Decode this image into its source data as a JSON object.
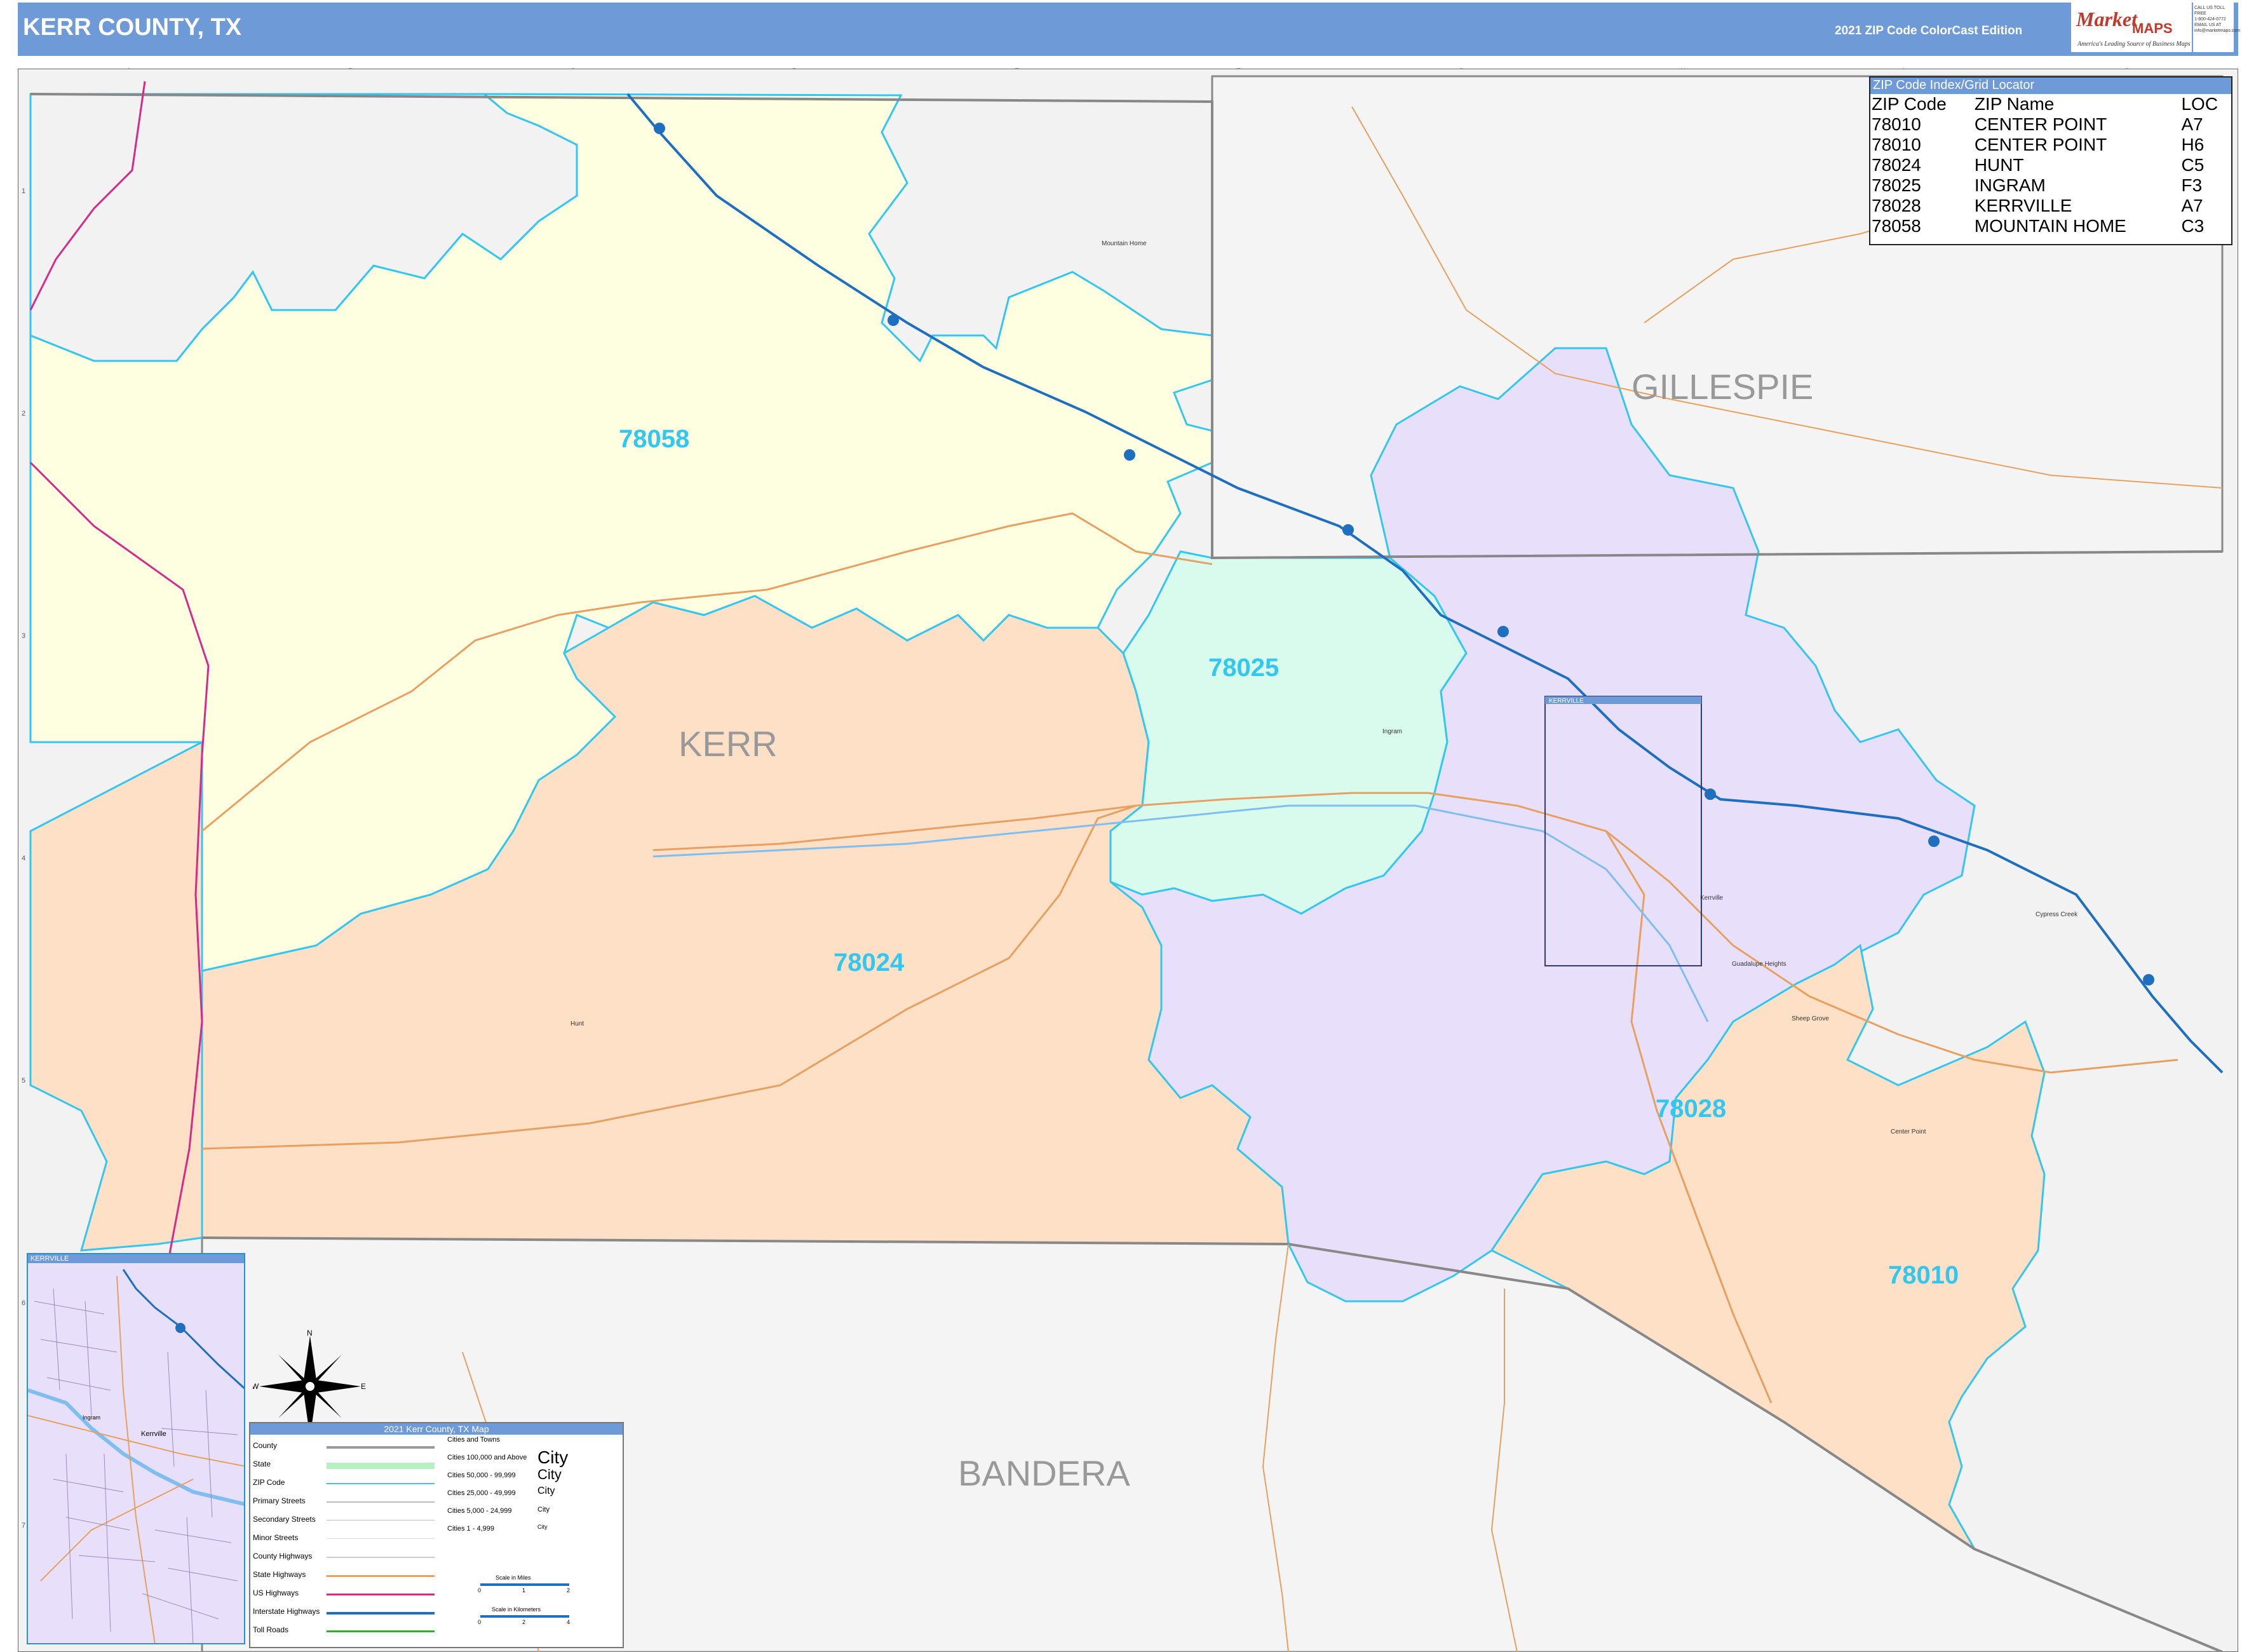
{
  "header": {
    "title": "KERR COUNTY, TX",
    "edition": "2021 ZIP Code ColorCast Edition",
    "logo_mark": "Market",
    "logo_maps": "MAPS",
    "logo_tagline": "America's Leading Source of Business Maps",
    "contact_lines": [
      "CALL US TOLL FREE",
      "1-800-424-0772",
      "EMAIL US AT",
      "info@marketmaps.com"
    ]
  },
  "grid": {
    "columns": [
      "A",
      "B",
      "C",
      "D",
      "E",
      "F",
      "G",
      "H",
      "I",
      "J"
    ],
    "rows": [
      "1",
      "2",
      "3",
      "4",
      "5",
      "6",
      "7"
    ]
  },
  "zip_index": {
    "title": "ZIP Code Index/Grid Locator",
    "headers": [
      "ZIP Code",
      "ZIP Name",
      "LOC"
    ],
    "rows": [
      [
        "78010",
        "CENTER POINT",
        "A7"
      ],
      [
        "78010",
        "CENTER POINT",
        "H6"
      ],
      [
        "78024",
        "HUNT",
        "C5"
      ],
      [
        "78025",
        "INGRAM",
        "F3"
      ],
      [
        "78028",
        "KERRVILLE",
        "A7"
      ],
      [
        "78058",
        "MOUNTAIN HOME",
        "C3"
      ]
    ]
  },
  "map": {
    "counties": {
      "kerr": "KERR",
      "gillespie": "GILLESPIE",
      "bandera": "BANDERA"
    },
    "zips": [
      {
        "code": "78058",
        "color": "#fefee0"
      },
      {
        "code": "78024",
        "color": "#fde0c6"
      },
      {
        "code": "78025",
        "color": "#d8fbee"
      },
      {
        "code": "78028",
        "color": "#e8e0fb"
      },
      {
        "code": "78010",
        "color": "#fde0c6"
      }
    ],
    "places": {
      "mountain_home": "Mountain Home",
      "ingram": "Ingram",
      "kerrville": "Kerrville",
      "hunt": "Hunt",
      "center_point": "Center Point",
      "cypress_creek": "Cypress Creek",
      "guadalupe_heights": "Guadalupe Heights",
      "sheep_grove": "Sheep Grove"
    },
    "kerrville_box_label": "KERRVILLE",
    "outside_color": "#f2f2f2",
    "zip_boundary_color": "#33c7f0",
    "interstate_color": "#1f6fc0",
    "state_highway_color": "#e8a060"
  },
  "inset": {
    "title": "KERRVILLE",
    "city_label": "Kerrville",
    "ingram_label": "Ingram"
  },
  "compass": {
    "n": "N",
    "s": "S",
    "e": "E",
    "w": "W"
  },
  "legend": {
    "title": "2021 Kerr County, TX Map",
    "rows": [
      "County",
      "State",
      "ZIP Code",
      "Primary Streets",
      "Secondary Streets",
      "Minor Streets",
      "County Highways",
      "State Highways",
      "US Highways",
      "Interstate Highways",
      "Toll Roads"
    ],
    "cities_header": "Cities and Towns",
    "city_classes": [
      "Cities 100,000 and Above",
      "Cities 50,000 - 99,999",
      "Cities 25,000 - 49,999",
      "Cities 5,000 - 24,999",
      "Cities 1 - 4,999"
    ],
    "city_sample": "City",
    "scale_miles_label": "Scale in Miles",
    "scale_km_label": "Scale in Kilometers",
    "scale_miles_ticks": [
      "0",
      "1",
      "2"
    ],
    "scale_km_ticks": [
      "0",
      "2",
      "4"
    ]
  }
}
